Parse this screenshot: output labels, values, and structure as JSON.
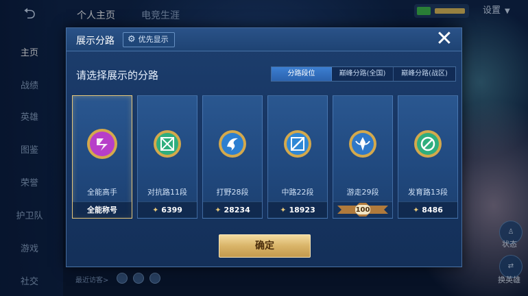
{
  "topbar": {
    "back_icon": "back-arrow-icon",
    "tabs": [
      {
        "label": "个人主页",
        "active": true
      },
      {
        "label": "电竞生涯",
        "active": false
      }
    ],
    "settings_label": "设置"
  },
  "sidebar": {
    "items": [
      {
        "label": "主页",
        "active": true
      },
      {
        "label": "战绩",
        "active": false
      },
      {
        "label": "英雄",
        "active": false
      },
      {
        "label": "图鉴",
        "active": false
      },
      {
        "label": "荣誉",
        "active": false
      },
      {
        "label": "护卫队",
        "active": false
      },
      {
        "label": "游戏",
        "active": false
      },
      {
        "label": "社交",
        "active": false
      }
    ]
  },
  "right_panel": {
    "btn1_label": "状态",
    "btn2_label": "换英雄"
  },
  "footer": {
    "visitors_label": "最近访客>"
  },
  "modal": {
    "title": "展示分路",
    "priority_button": "优先显示",
    "subtitle": "请选择展示的分路",
    "segments": [
      {
        "label": "分路段位",
        "active": true
      },
      {
        "label": "巅峰分路(全国)",
        "active": false
      },
      {
        "label": "巅峰分路(战区)",
        "active": false
      }
    ],
    "cards": [
      {
        "label": "全能高手",
        "footer": "全能称号",
        "badge": "all-round-badge-icon",
        "selected": true,
        "color": "#b73ec9"
      },
      {
        "label": "对抗路11段",
        "footer": "6399",
        "badge": "clash-lane-badge-icon",
        "selected": false,
        "color": "#2fae7e"
      },
      {
        "label": "打野28段",
        "footer": "28234",
        "badge": "jungle-badge-icon",
        "selected": false,
        "color": "#2d7fd0"
      },
      {
        "label": "中路22段",
        "footer": "18923",
        "badge": "mid-lane-badge-icon",
        "selected": false,
        "color": "#2f88d6"
      },
      {
        "label": "游走29段",
        "footer": "100",
        "badge": "roam-badge-icon",
        "selected": false,
        "color": "#2f78c8"
      },
      {
        "label": "发育路13段",
        "footer": "8486",
        "badge": "farm-lane-badge-icon",
        "selected": false,
        "color": "#2fae7e"
      }
    ],
    "confirm_label": "确定"
  },
  "colors": {
    "gold": "#e6c77a",
    "accent_blue": "#3c7fd2"
  }
}
